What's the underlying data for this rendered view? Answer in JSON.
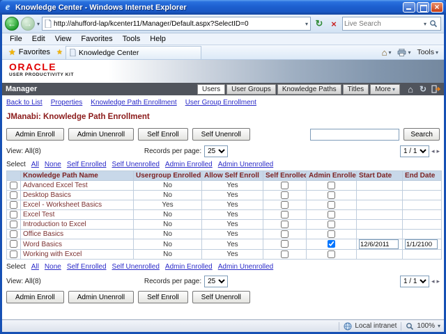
{
  "window": {
    "title": "Knowledge Center - Windows Internet Explorer",
    "address": "http://ahufford-lap/kcenter11/Manager/Default.aspx?SelectID=0",
    "search_placeholder": "Live Search",
    "menu": [
      "File",
      "Edit",
      "View",
      "Favorites",
      "Tools",
      "Help"
    ],
    "favorites_label": "Favorites",
    "tab_title": "Knowledge Center",
    "tools_label": "Tools",
    "status_zone": "Local intranet",
    "zoom_level": "100%"
  },
  "icons": {
    "back_arrow": "←",
    "forward_arrow": "→",
    "refresh": "↻",
    "stop": "×",
    "favorites_star": "★",
    "home": "⌂",
    "prev_page": "◂",
    "next_page": "▸"
  },
  "brand": {
    "logo": "ORACLE",
    "subtitle": "USER PRODUCTIVITY KIT"
  },
  "manager": {
    "label": "Manager",
    "tabs": [
      {
        "label": "Users",
        "active": true
      },
      {
        "label": "User Groups",
        "active": false
      },
      {
        "label": "Knowledge Paths",
        "active": false
      },
      {
        "label": "Titles",
        "active": false
      },
      {
        "label": "More",
        "active": false
      }
    ]
  },
  "page": {
    "breadcrumbs": [
      "Back to List",
      "Properties",
      "Knowledge Path Enrollment",
      "User Group Enrollment"
    ],
    "title": "JManabi: Knowledge Path Enrollment",
    "action_buttons": [
      "Admin Enroll",
      "Admin Unenroll",
      "Self Enroll",
      "Self Unenroll"
    ],
    "search_button": "Search",
    "search_value": "",
    "view_label": "View: All(8)",
    "records_per_page_label": "Records per page:",
    "records_per_page_value": "25",
    "page_indicator": "1 / 1",
    "select_label": "Select",
    "select_links": [
      "All",
      "None",
      "Self Enrolled",
      "Self Unenrolled",
      "Admin Enrolled",
      "Admin Unenrolled"
    ]
  },
  "table": {
    "headers": [
      "Knowledge Path Name",
      "Usergroup Enrolled",
      "Allow Self Enroll",
      "Self Enrolled",
      "Admin Enrolled",
      "Start Date",
      "End Date"
    ],
    "rows": [
      {
        "name": "Advanced Excel Test",
        "usergroup_enrolled": "No",
        "allow_self_enroll": "Yes",
        "self_enrolled": false,
        "admin_enrolled": false,
        "start_date": "",
        "end_date": ""
      },
      {
        "name": "Desktop Basics",
        "usergroup_enrolled": "No",
        "allow_self_enroll": "Yes",
        "self_enrolled": false,
        "admin_enrolled": false,
        "start_date": "",
        "end_date": ""
      },
      {
        "name": "Excel - Worksheet Basics",
        "usergroup_enrolled": "Yes",
        "allow_self_enroll": "Yes",
        "self_enrolled": false,
        "admin_enrolled": false,
        "start_date": "",
        "end_date": ""
      },
      {
        "name": "Excel Test",
        "usergroup_enrolled": "No",
        "allow_self_enroll": "Yes",
        "self_enrolled": false,
        "admin_enrolled": false,
        "start_date": "",
        "end_date": ""
      },
      {
        "name": "Introduction to Excel",
        "usergroup_enrolled": "No",
        "allow_self_enroll": "Yes",
        "self_enrolled": false,
        "admin_enrolled": false,
        "start_date": "",
        "end_date": ""
      },
      {
        "name": "Office Basics",
        "usergroup_enrolled": "No",
        "allow_self_enroll": "Yes",
        "self_enrolled": false,
        "admin_enrolled": false,
        "start_date": "",
        "end_date": ""
      },
      {
        "name": "Word Basics",
        "usergroup_enrolled": "No",
        "allow_self_enroll": "Yes",
        "self_enrolled": false,
        "admin_enrolled": true,
        "start_date": "12/6/2011",
        "end_date": "1/1/2100"
      },
      {
        "name": "Working with Excel",
        "usergroup_enrolled": "No",
        "allow_self_enroll": "Yes",
        "self_enrolled": false,
        "admin_enrolled": false,
        "start_date": "",
        "end_date": ""
      }
    ]
  },
  "colors": {
    "oracle_red": "#E00000",
    "page_title_maroon": "#8B1A1A",
    "link_blue": "#2A2AC8",
    "table_header_bg": "#C8D8E9",
    "titlebar_blue": "#1C5FD0",
    "manager_bar": "#50545C"
  }
}
